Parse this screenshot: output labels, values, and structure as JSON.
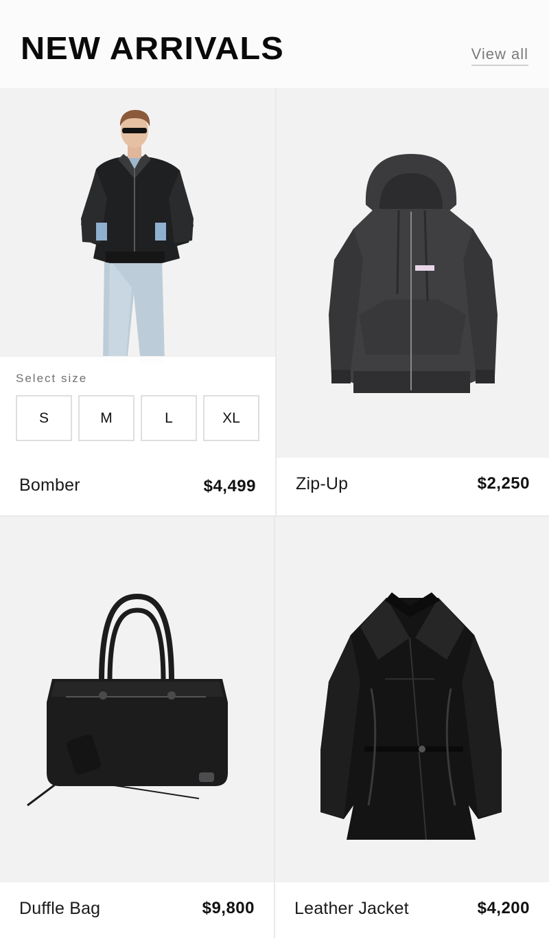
{
  "header": {
    "title": "NEW ARRIVALS",
    "view_all": "View all"
  },
  "products": [
    {
      "name": "Bomber",
      "price": "$4,499",
      "image": "bomber-jacket-on-model",
      "size_selector": {
        "label": "Select size",
        "options": [
          "S",
          "M",
          "L",
          "XL"
        ]
      }
    },
    {
      "name": "Zip-Up",
      "price": "$2,250",
      "image": "zip-up-hoodie"
    },
    {
      "name": "Duffle Bag",
      "price": "$9,800",
      "image": "black-leather-duffle-bag"
    },
    {
      "name": "Leather Jacket",
      "price": "$4,200",
      "image": "black-leather-jacket"
    }
  ],
  "colors": {
    "background": "#ffffff",
    "image_background": "#f3f2f2",
    "title": "#0a0a0a",
    "link": "#7a7a7a",
    "product_dark": "#1c1c1c"
  }
}
